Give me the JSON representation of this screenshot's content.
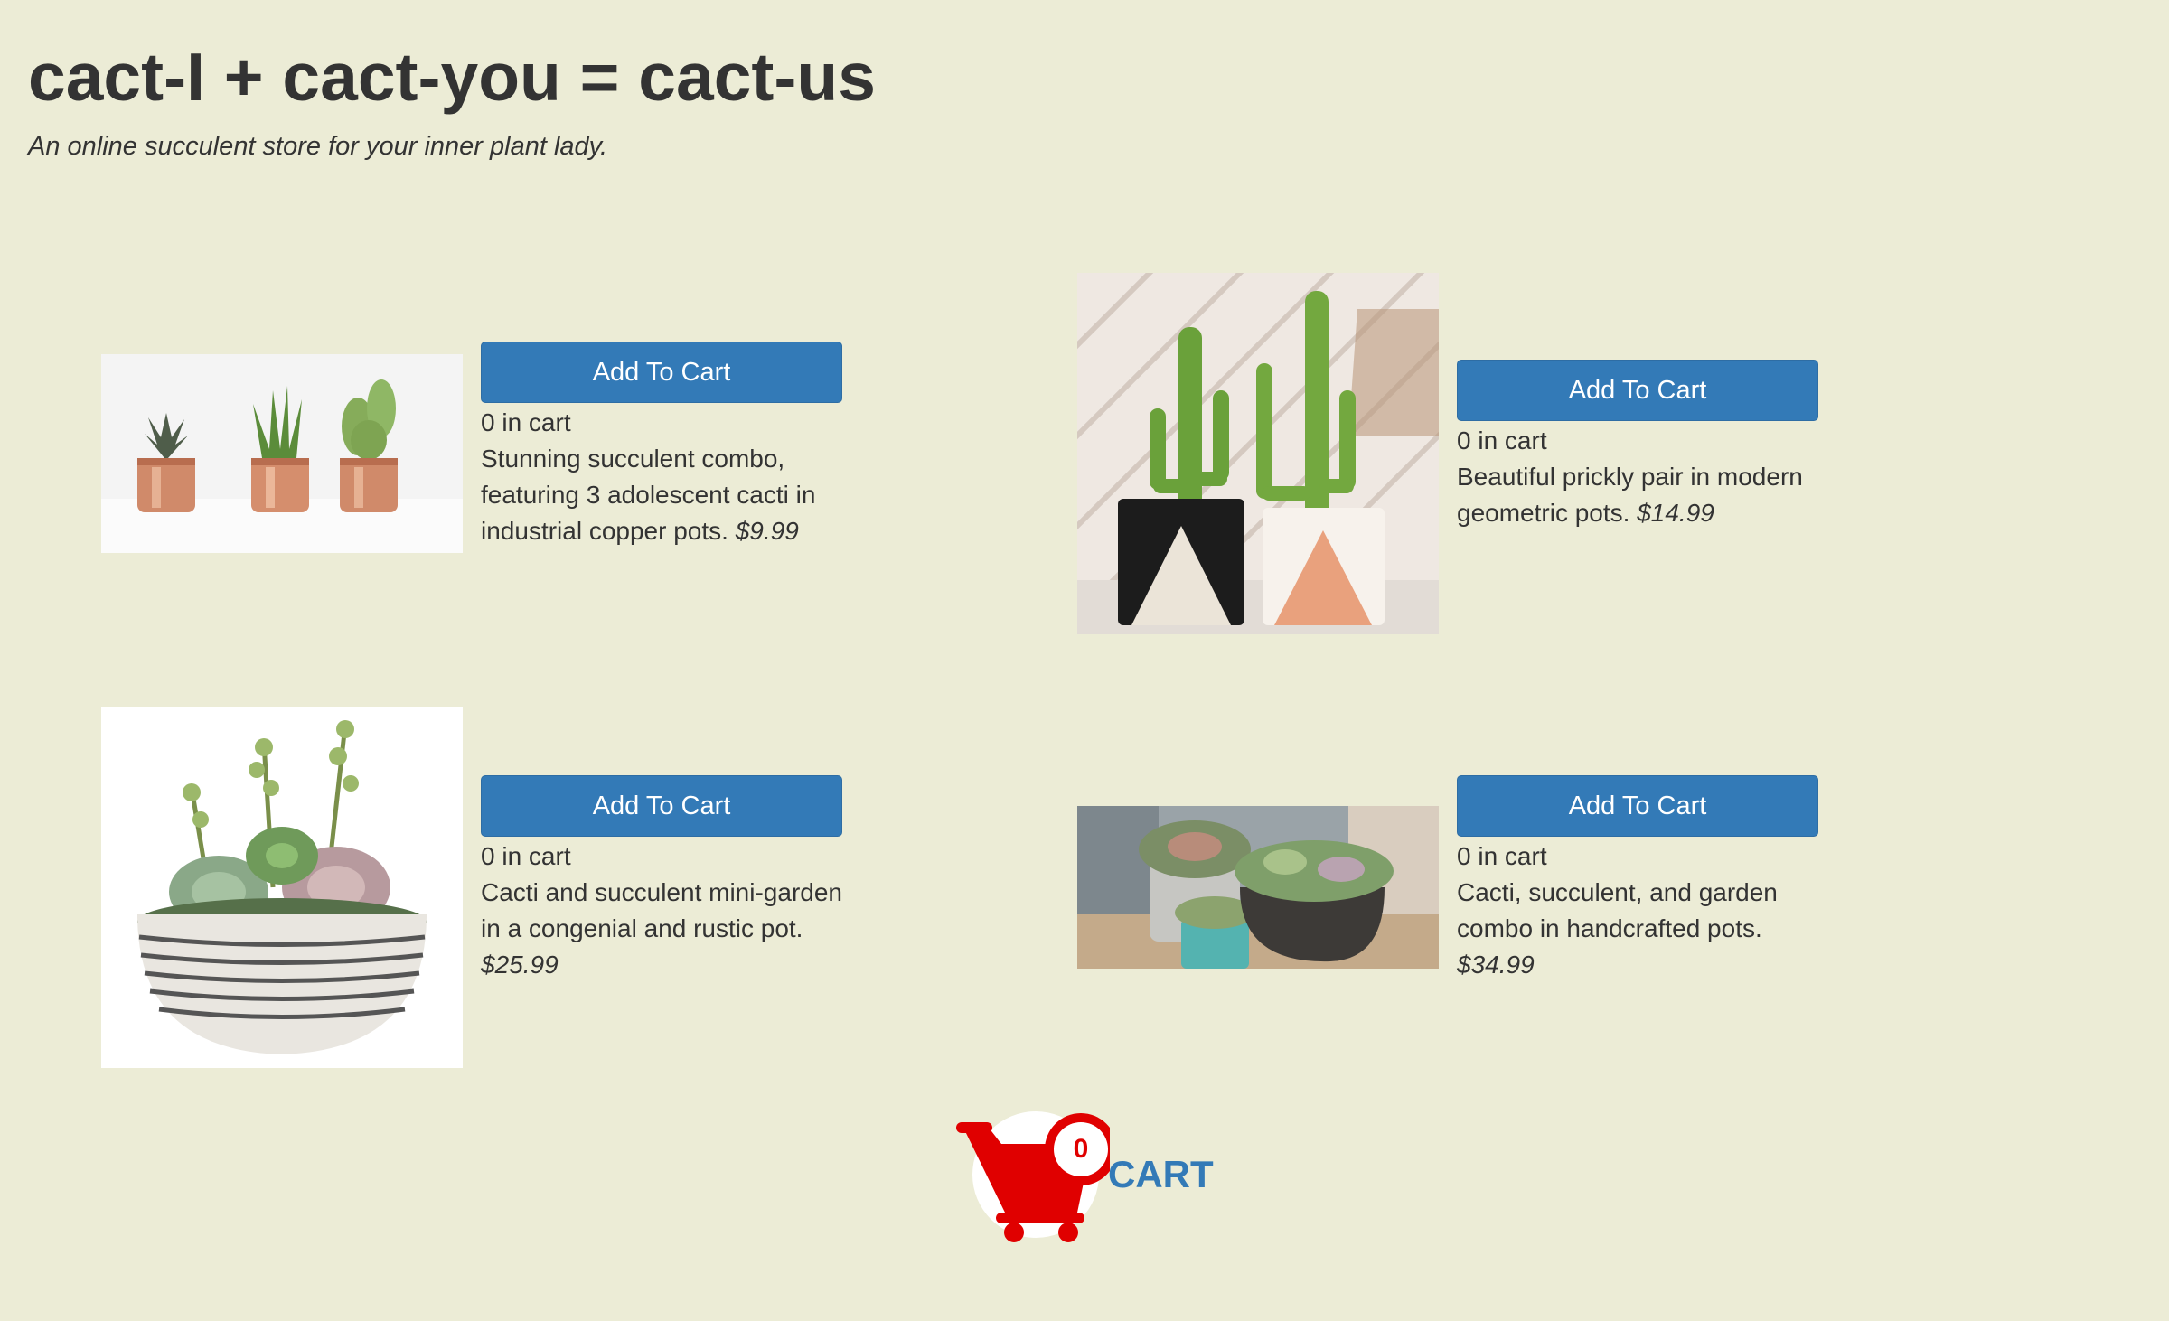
{
  "header": {
    "title": "cact-I + cact-you = cact-us",
    "tagline": "An online succulent store for your inner plant lady."
  },
  "products": [
    {
      "button_label": "Add To Cart",
      "quantity_text": "0 in cart",
      "description": "Stunning succulent combo, featuring 3 adolescent cacti in industrial copper pots.",
      "price": "$9.99"
    },
    {
      "button_label": "Add To Cart",
      "quantity_text": "0 in cart",
      "description": "Beautiful prickly pair in modern geometric pots.",
      "price": "$14.99"
    },
    {
      "button_label": "Add To Cart",
      "quantity_text": "0 in cart",
      "description": "Cacti and succulent mini-garden in a congenial and rustic pot.",
      "price": "$25.99"
    },
    {
      "button_label": "Add To Cart",
      "quantity_text": "0 in cart",
      "description": "Cacti, succulent, and garden combo in handcrafted pots.",
      "price": "$34.99"
    }
  ],
  "cart": {
    "count": "0",
    "label": "CART"
  },
  "colors": {
    "background": "#ececd6",
    "button": "#337ab7",
    "cart_red": "#e00000"
  }
}
